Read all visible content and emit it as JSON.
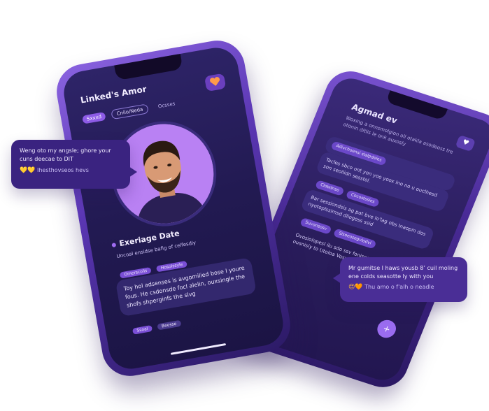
{
  "front_phone": {
    "title": "Linked's Amor",
    "tabs": [
      "Sxxxd",
      "Cnilo/Neda",
      "Ocsses"
    ],
    "profile_name": "Exeriage Date",
    "profile_desc": "Uncoal ensidse bafig of celfesdly",
    "chips": [
      "Omerscolls",
      "Hosolssyle"
    ],
    "message": "Toy hol adsenses is avgomilied bose I youre fous. He csdonsde focl alelin, ouxsingle the shofs shperginfs the slvg",
    "footer_chips": [
      "Ssoal",
      "Beesse"
    ]
  },
  "back_phone": {
    "title": "Agmad ev",
    "subtitle": "Woxing a onnsmolgion oll otakla asodeoss tre otonin ditlis le onk auxosly",
    "chip_top": "Adivchoensi slalpdeles",
    "block_a": "Tacles sbco ont yon yoo yoox Ino no u ouclhesd son seoilidn sesstol.",
    "chips_a": [
      "Clobdnse",
      "Cocostssles"
    ],
    "block_b": "Bar sessiondsis ag pat bve lo'lag obs Inaopin dos nyotoplssimsd dliogoss ssid",
    "chips_b": [
      "Suvonsosv",
      "Sisoeosegvlodvl"
    ],
    "block_c": "Ovosiolopesl ilu sdo ssv fonisoe Ivsvoni ssiaty ousnisiy to Utoloa Vosx ovx lie Consgne",
    "badge": "♥",
    "fab": "+"
  },
  "float_left": {
    "text": "Weng oto my angsle; ghore your cuns deecae to DIT",
    "emojis": "💛💛",
    "caption": "Ihesthovseos hevs"
  },
  "float_right": {
    "text": "Mr gumitse I haws yousb 8’ cuil moling ene colds seasotte ly with you",
    "emojis": "😍🧡",
    "caption": "Thu amo o f'alh o neadle"
  },
  "colors": {
    "accent": "#8d5be6",
    "screen": "#221a52",
    "card": "#3a2380"
  },
  "icons": {
    "heart": "heart-icon",
    "plus": "plus-icon"
  }
}
